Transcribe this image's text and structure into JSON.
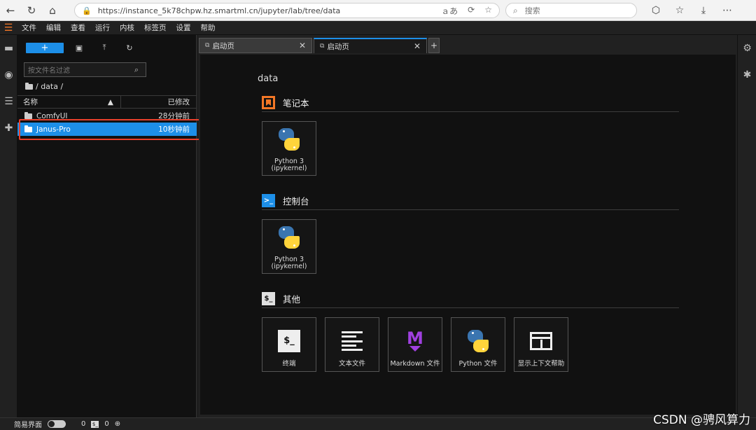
{
  "browser": {
    "url": "https://instance_5k78chpw.hz.smartml.cn/jupyter/lab/tree/data",
    "search_placeholder": "搜索",
    "font_toggle": "ａあ"
  },
  "menubar": {
    "items": [
      "文件",
      "编辑",
      "查看",
      "运行",
      "内核",
      "标签页",
      "设置",
      "帮助"
    ]
  },
  "filebrowser": {
    "new_label": "+",
    "filter_placeholder": "按文件名过滤",
    "breadcrumb": "/ data /",
    "header": {
      "name": "名称",
      "modified": "已修改"
    },
    "rows": [
      {
        "name": "ComfyUI",
        "modified": "28分钟前",
        "selected": false
      },
      {
        "name": "Janus-Pro",
        "modified": "10秒钟前",
        "selected": true
      }
    ]
  },
  "tabs": [
    {
      "label": "启动页",
      "active": false
    },
    {
      "label": "启动页",
      "active": true
    }
  ],
  "launcher": {
    "title": "data",
    "sections": [
      {
        "title": "笔记本",
        "cards": [
          {
            "line1": "Python 3",
            "line2": "(ipykernel)"
          }
        ]
      },
      {
        "title": "控制台",
        "cards": [
          {
            "line1": "Python 3",
            "line2": "(ipykernel)"
          }
        ]
      },
      {
        "title": "其他",
        "cards": [
          {
            "label": "终端"
          },
          {
            "label": "文本文件"
          },
          {
            "label": "Markdown 文件"
          },
          {
            "label": "Python 文件"
          },
          {
            "label": "显示上下文帮助"
          }
        ]
      }
    ]
  },
  "statusbar": {
    "simple_mode": "简易界面",
    "terminals": "0",
    "kernels": "0"
  },
  "watermark": "CSDN @骋风算力",
  "colors": {
    "accent": "#1d8fe8",
    "jupyter_orange": "#f37726",
    "highlight_red": "#e8402c"
  }
}
